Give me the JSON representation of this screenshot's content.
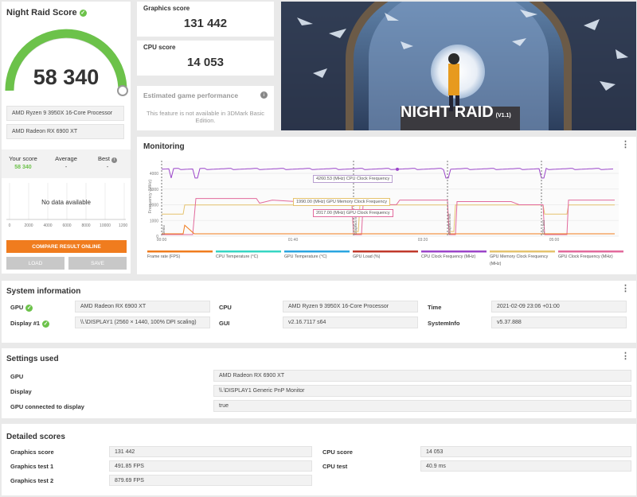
{
  "score_panel": {
    "title": "Night Raid Score",
    "score": "58 340",
    "gauge_fraction": 0.98,
    "cpu_name": "AMD Ryzen 9 3950X 16-Core Processor",
    "gpu_name": "AMD Radeon RX 6900 XT",
    "your_score_label": "Your score",
    "your_score_value": "58 340",
    "average_label": "Average",
    "average_value": "-",
    "best_label": "Best",
    "best_value": "-",
    "no_data": "No data available",
    "axis_ticks": [
      "0",
      "2000",
      "4000",
      "6000",
      "8000",
      "10000",
      "12000"
    ],
    "compare_button": "COMPARE RESULT ONLINE",
    "load_button": "LOAD",
    "save_button": "SAVE"
  },
  "graphics_score": {
    "label": "Graphics score",
    "value": "131 442"
  },
  "cpu_score": {
    "label": "CPU score",
    "value": "14 053"
  },
  "game_perf": {
    "title": "Estimated game performance",
    "text": "This feature is not available in 3DMark Basic Edition."
  },
  "banner": {
    "title": "NIGHT RAID",
    "version": "(V1.1)"
  },
  "monitoring": {
    "title": "Monitoring",
    "y_axis_label": "Frequency (MHz)",
    "y_ticks": [
      "4000",
      "3000",
      "2000",
      "1000",
      "0"
    ],
    "x_ticks": [
      "00:00",
      "01:40",
      "03:20",
      "05:00"
    ],
    "tooltips": [
      "4260.53 (MHz) CPU Clock Frequency",
      "1990.00 (MHz) GPU Memory Clock Frequency",
      "2017.00 (MHz) GPU Clock Frequency"
    ],
    "markers": [
      "Demo",
      "Graphics test",
      "Graphics test",
      "CPU test"
    ],
    "legend": [
      {
        "label": "Frame rate (FPS)",
        "color": "#f07c1e"
      },
      {
        "label": "CPU Temperature (°C)",
        "color": "#37d6c3"
      },
      {
        "label": "GPU Temperature (°C)",
        "color": "#2aa5e0"
      },
      {
        "label": "GPU Load (%)",
        "color": "#c0392b"
      },
      {
        "label": "CPU Clock Frequency (MHz)",
        "color": "#9b45c9"
      },
      {
        "label": "GPU Memory Clock Frequency (MHz)",
        "color": "#e5c36e"
      },
      {
        "label": "GPU Clock Frequency (MHz)",
        "color": "#e26a9c"
      }
    ]
  },
  "system_info": {
    "title": "System information",
    "gpu_label": "GPU",
    "gpu_value": "AMD Radeon RX 6900 XT",
    "display_label": "Display #1",
    "display_value": "\\\\.\\DISPLAY1 (2560 × 1440, 100% DPI scaling)",
    "cpu_label": "CPU",
    "cpu_value": "AMD Ryzen 9 3950X 16-Core Processor",
    "gui_label": "GUI",
    "gui_value": "v2.16.7117 s64",
    "time_label": "Time",
    "time_value": "2021-02-09 23:06 +01:00",
    "sysinfo_label": "SystemInfo",
    "sysinfo_value": "v5.37.888"
  },
  "settings": {
    "title": "Settings used",
    "rows": [
      {
        "label": "GPU",
        "value": "AMD Radeon RX 6900 XT"
      },
      {
        "label": "Display",
        "value": "\\\\.\\DISPLAY1 Generic PnP Monitor"
      },
      {
        "label": "GPU connected to display",
        "value": "true"
      }
    ]
  },
  "detailed": {
    "title": "Detailed scores",
    "left": [
      {
        "label": "Graphics score",
        "value": "131 442"
      },
      {
        "label": "Graphics test 1",
        "value": "491.85 FPS"
      },
      {
        "label": "Graphics test 2",
        "value": "879.69 FPS"
      }
    ],
    "right": [
      {
        "label": "CPU score",
        "value": "14 053"
      },
      {
        "label": "CPU test",
        "value": "40.9 ms"
      }
    ]
  }
}
